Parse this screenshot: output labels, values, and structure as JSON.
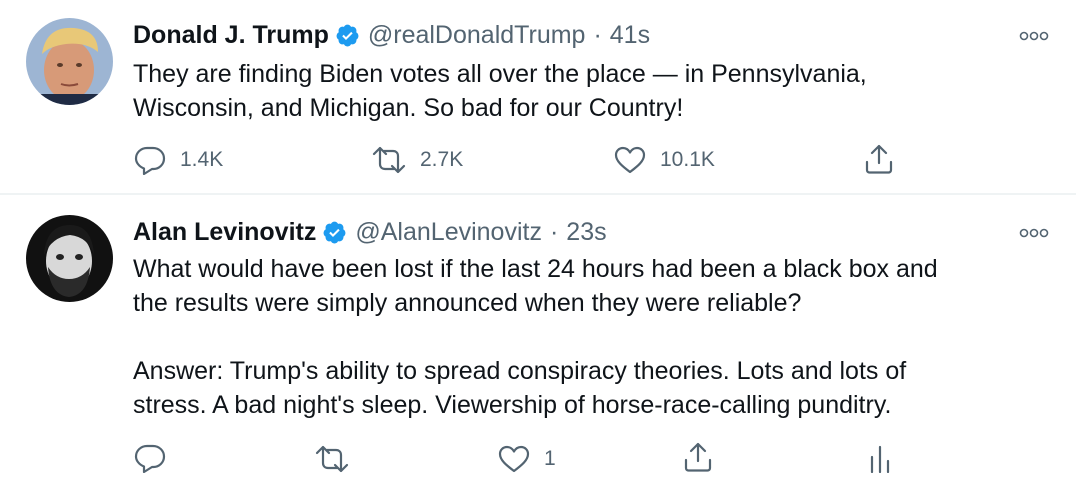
{
  "tweets": [
    {
      "name": "Donald J. Trump",
      "handle": "@realDonaldTrump",
      "separator": "·",
      "time": "41s",
      "text": [
        "They are finding Biden votes all over the place — in Pennsylvania,",
        "Wisconsin, and Michigan. So bad for our Country!"
      ],
      "replies": "1.4K",
      "retweets": "2.7K",
      "likes": "10.1K"
    },
    {
      "name": "Alan Levinovitz",
      "handle": "@AlanLevinovitz",
      "separator": "·",
      "time": "23s",
      "text": [
        "What would have been lost if the last 24 hours had been a black box and",
        "the results were simply announced when they were reliable?"
      ],
      "text2": [
        "Answer: Trump's ability to spread conspiracy theories. Lots and lots of",
        "stress. A bad night's sleep. Viewership of horse-race-calling punditry."
      ],
      "likes": "1"
    }
  ],
  "colors": {
    "verified": "#1d9bf0",
    "secondary_text": "#536471",
    "divider": "#eff3f4"
  },
  "icons": [
    "verified-badge-icon",
    "more-icon",
    "reply-icon",
    "retweet-icon",
    "like-icon",
    "share-icon",
    "analytics-icon"
  ]
}
